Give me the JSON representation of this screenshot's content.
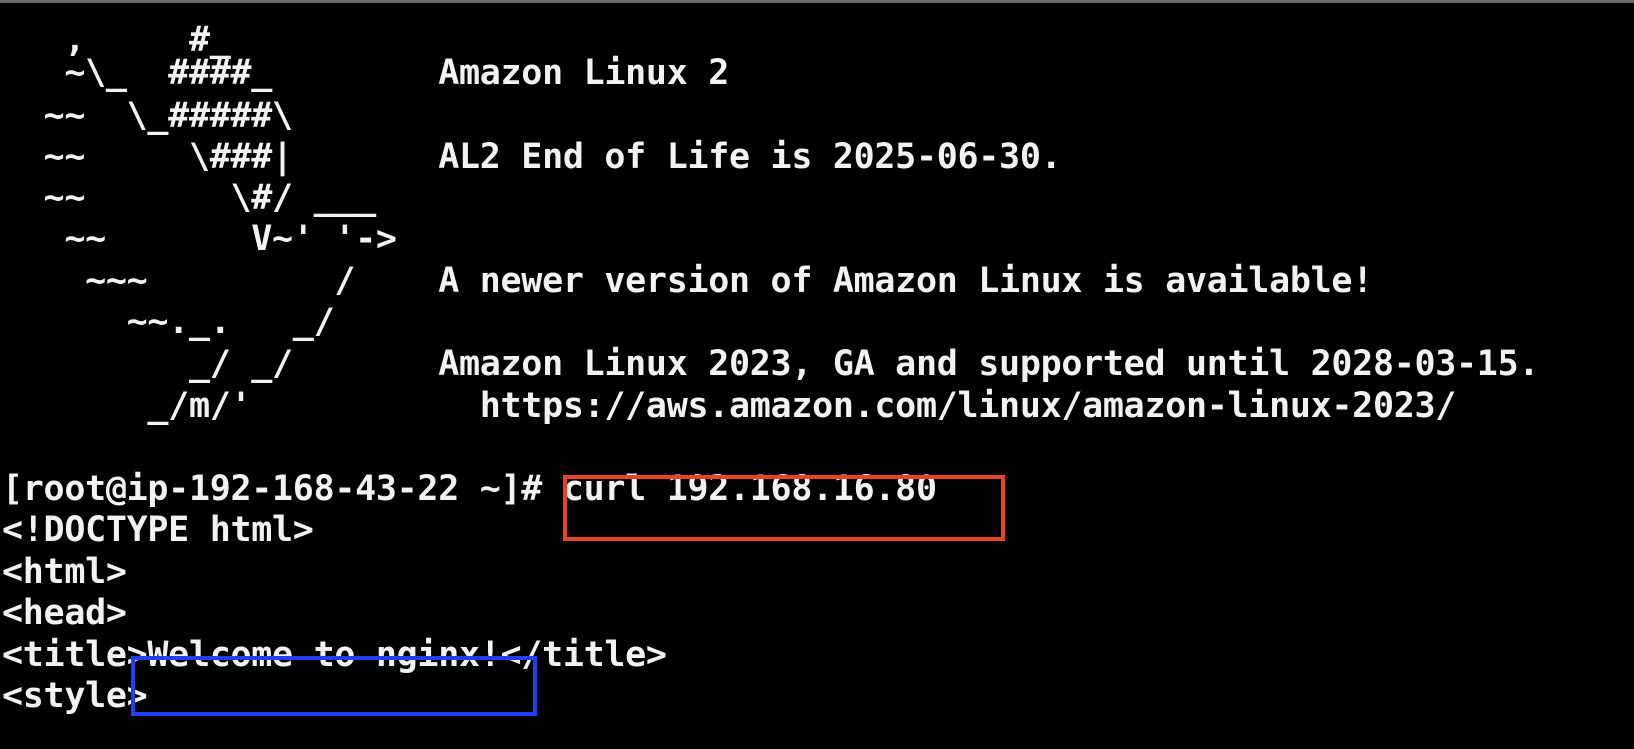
{
  "terminal": {
    "lines": [
      "   ,     #_",
      "   ~\\_  ####_        Amazon Linux 2",
      "  ~~  \\_#####\\",
      "  ~~     \\###|       AL2 End of Life is 2025-06-30.",
      "  ~~       \\#/ ___",
      "   ~~       V~' '->",
      "    ~~~         /    A newer version of Amazon Linux is available!",
      "      ~~._.   _/",
      "         _/ _/       Amazon Linux 2023, GA and supported until 2028-03-15.",
      "       _/m/'           https://aws.amazon.com/linux/amazon-linux-2023/",
      "",
      "[root@ip-192-168-43-22 ~]# curl 192.168.16.80",
      "<!DOCTYPE html>",
      "<html>",
      "<head>",
      "<title>Welcome to nginx!</title>",
      "<style>"
    ]
  },
  "highlights": {
    "command_box_color": "#e8432a",
    "title_box_color": "#1f3ff0"
  },
  "colors": {
    "background": "#000000",
    "foreground": "#f2f2f2"
  }
}
